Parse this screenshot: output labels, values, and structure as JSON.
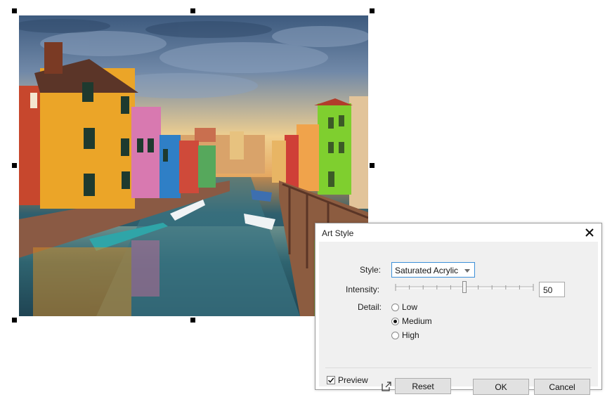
{
  "image": {
    "description_icon": "painted-canal-photo"
  },
  "dialog": {
    "title": "Art Style",
    "close_icon": "close-icon",
    "style_label": "Style:",
    "style_value": "Saturated Acrylic",
    "intensity_label": "Intensity:",
    "intensity_value": "50",
    "intensity_fraction": 0.5,
    "detail_label": "Detail:",
    "detail_options": [
      "Low",
      "Medium",
      "High"
    ],
    "detail_selected": "Medium",
    "preview_label": "Preview",
    "preview_checked": true,
    "reset_label": "Reset",
    "ok_label": "OK",
    "cancel_label": "Cancel"
  },
  "colors": {
    "panel_bg": "#f0f0f0",
    "accent": "#3c8fd8",
    "button_bg": "#e1e1e1"
  }
}
